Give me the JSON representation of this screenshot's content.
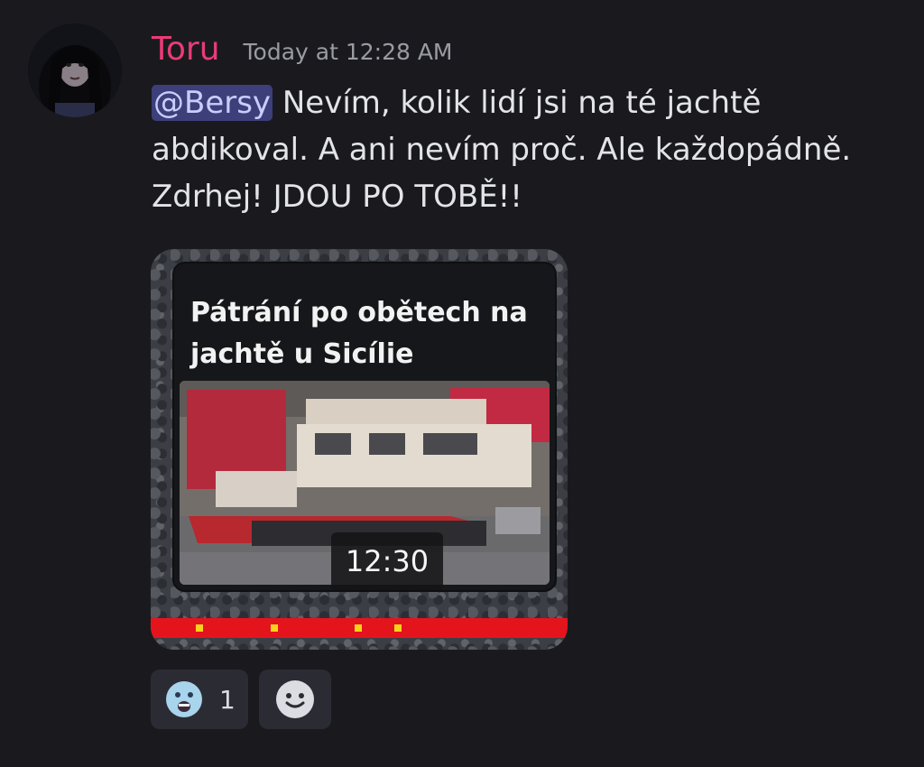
{
  "message": {
    "author": "Toru",
    "timestamp": "Today at 12:28 AM",
    "mention": "@Bersy",
    "text": " Nevím, kolik lidí jsi na té jachtě abdikoval. A ani nevím proč. Ale každopádně. Zdrhej! JDOU PO TOBĚ!!"
  },
  "embed": {
    "video_title": "Pátrání po obětech na jachtě u Sicílie",
    "duration": "12:30",
    "icon": "video-thumbnail"
  },
  "reactions": [
    {
      "icon": "scared-face-emoji",
      "count": "1"
    },
    {
      "icon": "add-reaction-smiley-icon"
    }
  ],
  "colors": {
    "username": "#ea3b77",
    "mention_bg": "#3c3f7a",
    "background": "#1a1a1e",
    "progress": "#e4141d"
  }
}
